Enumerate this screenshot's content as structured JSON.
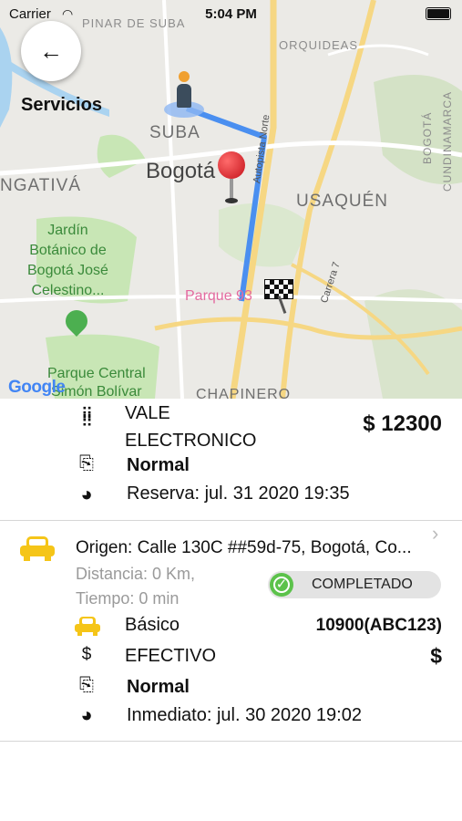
{
  "status_bar": {
    "carrier": "Carrier",
    "time": "5:04 PM"
  },
  "header": {
    "title": "Servicios"
  },
  "map": {
    "labels": {
      "pinar": "PINAR DE SUBA",
      "orquideas": "ORQUIDEAS",
      "suba": "SUBA",
      "bogota": "Bogotá",
      "engativa": "NGATIVÁ",
      "usaquen": "USAQUÉN",
      "autopista": "Autopista Norte",
      "carrera7": "Carrera 7",
      "jardin": "Jardín\nBotánico de\nBogotá José\nCelestino...",
      "parque93": "Parque 93",
      "parque_central": "Parque Central\nSimón Bolívar",
      "chapinero": "CHAPINERO",
      "bogota_vert": "BOGOTÁ",
      "cundinamarca": "CUNDINAMARCA",
      "google": "Google"
    },
    "route_color": "#4a8ff0"
  },
  "service1": {
    "payment_label": "VALE\nELECTRONICO",
    "price": "$ 12300",
    "type": "Normal",
    "schedule": "Reserva: jul. 31 2020 19:35"
  },
  "service2": {
    "origin": "Origen: Calle 130C ##59d-75, Bogotá, Co...",
    "distance": "Distancia: 0 Km,",
    "time": "Tiempo: 0 min",
    "status": "COMPLETADO",
    "vehicle": "Básico",
    "plate": "10900(ABC123)",
    "payment_label": "EFECTIVO",
    "payment_symbol": "$",
    "currency_icon": "$",
    "type": "Normal",
    "schedule": "Inmediato: jul. 30 2020 19:02"
  },
  "colors": {
    "accent_yellow": "#f5c518",
    "status_green": "#5cc24b"
  }
}
